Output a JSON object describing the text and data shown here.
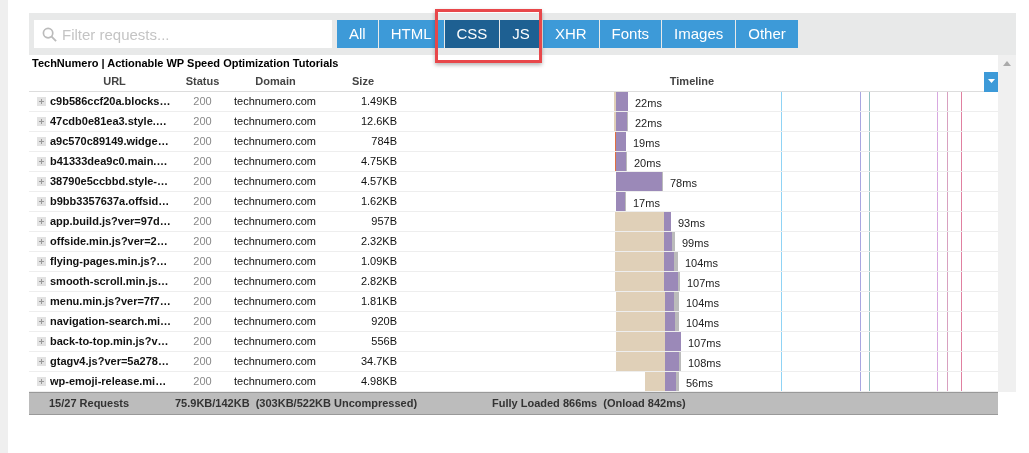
{
  "filter": {
    "placeholder": "Filter requests..."
  },
  "tabs": [
    {
      "label": "All",
      "selected": false
    },
    {
      "label": "HTML",
      "selected": false
    },
    {
      "label": "CSS",
      "selected": true
    },
    {
      "label": "JS",
      "selected": true
    },
    {
      "label": "XHR",
      "selected": false
    },
    {
      "label": "Fonts",
      "selected": false
    },
    {
      "label": "Images",
      "selected": false
    },
    {
      "label": "Other",
      "selected": false
    }
  ],
  "page_title": "TechNumero | Actionable WP Speed Optimization Tutorials",
  "columns": [
    "URL",
    "Status",
    "Domain",
    "Size",
    "Timeline"
  ],
  "rows": [
    {
      "url": "c9b586ccf20a.blocks…",
      "status": "200",
      "domain": "technumero.com",
      "size": "1.49KB",
      "time": "22ms"
    },
    {
      "url": "47cdb0e81ea3.style.…",
      "status": "200",
      "domain": "technumero.com",
      "size": "12.6KB",
      "time": "22ms"
    },
    {
      "url": "a9c570c89149.widge…",
      "status": "200",
      "domain": "technumero.com",
      "size": "784B",
      "time": "19ms"
    },
    {
      "url": "b41333dea9c0.main.…",
      "status": "200",
      "domain": "technumero.com",
      "size": "4.75KB",
      "time": "20ms"
    },
    {
      "url": "38790e5ccbbd.style-…",
      "status": "200",
      "domain": "technumero.com",
      "size": "4.57KB",
      "time": "78ms"
    },
    {
      "url": "b9bb3357637a.offsid…",
      "status": "200",
      "domain": "technumero.com",
      "size": "1.62KB",
      "time": "17ms"
    },
    {
      "url": "app.build.js?ver=97d…",
      "status": "200",
      "domain": "technumero.com",
      "size": "957B",
      "time": "93ms"
    },
    {
      "url": "offside.min.js?ver=2…",
      "status": "200",
      "domain": "technumero.com",
      "size": "2.32KB",
      "time": "99ms"
    },
    {
      "url": "flying-pages.min.js?…",
      "status": "200",
      "domain": "technumero.com",
      "size": "1.09KB",
      "time": "104ms"
    },
    {
      "url": "smooth-scroll.min.js…",
      "status": "200",
      "domain": "technumero.com",
      "size": "2.82KB",
      "time": "107ms"
    },
    {
      "url": "menu.min.js?ver=7f7…",
      "status": "200",
      "domain": "technumero.com",
      "size": "1.81KB",
      "time": "104ms"
    },
    {
      "url": "navigation-search.mi…",
      "status": "200",
      "domain": "technumero.com",
      "size": "920B",
      "time": "104ms"
    },
    {
      "url": "back-to-top.min.js?v…",
      "status": "200",
      "domain": "technumero.com",
      "size": "556B",
      "time": "107ms"
    },
    {
      "url": "gtagv4.js?ver=5a278…",
      "status": "200",
      "domain": "technumero.com",
      "size": "34.7KB",
      "time": "108ms"
    },
    {
      "url": "wp-emoji-release.mi…",
      "status": "200",
      "domain": "technumero.com",
      "size": "4.98KB",
      "time": "56ms"
    }
  ],
  "footer": [
    "15/27 Requests",
    "75.9KB/142KB  (303KB/522KB Uncompressed)",
    "Fully Loaded 866ms  (Onload 842ms)"
  ]
}
